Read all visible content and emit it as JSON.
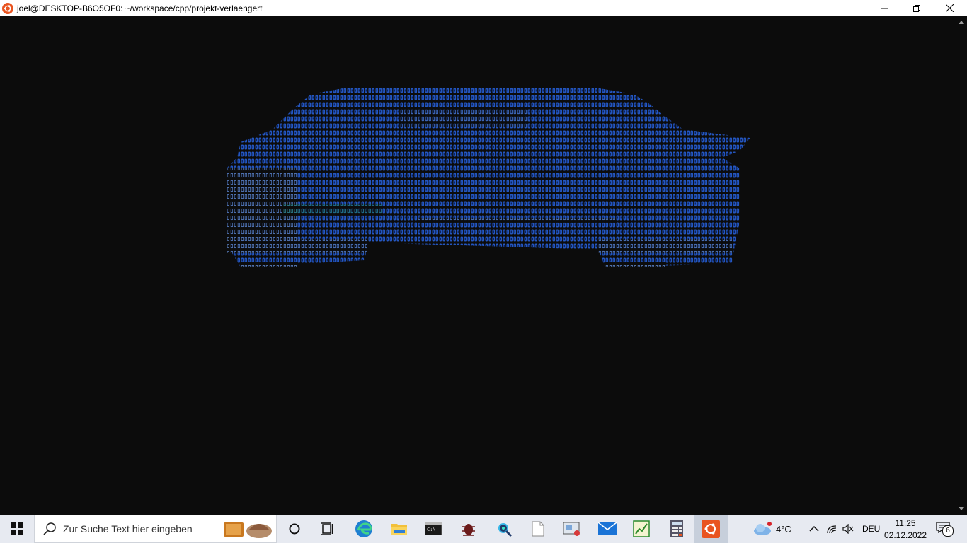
{
  "window": {
    "title": "joel@DESKTOP-B6O5OF0: ~/workspace/cpp/projekt-verlaengert",
    "minimize_icon": "minimize-icon",
    "restore_icon": "restore-icon",
    "close_icon": "close-icon"
  },
  "terminal": {
    "ascii_art": "car rendered in ASCII characters",
    "art_colors": [
      "#1f4fb0",
      "#2a5fc8",
      "#1d6f6a",
      "#6a7faf"
    ]
  },
  "taskbar": {
    "search_placeholder": "Zur Suche Text hier eingeben",
    "pinned": [
      {
        "icon": "windows-start-icon"
      },
      {
        "icon": "search-icon"
      },
      {
        "icon": "cortana-icon"
      },
      {
        "icon": "task-view-icon"
      },
      {
        "icon": "edge-icon"
      },
      {
        "icon": "file-explorer-icon"
      },
      {
        "icon": "terminal-icon"
      },
      {
        "icon": "bug-icon"
      },
      {
        "icon": "network-tool-icon"
      },
      {
        "icon": "document-icon"
      },
      {
        "icon": "remote-desktop-icon"
      },
      {
        "icon": "mail-icon"
      },
      {
        "icon": "chart-app-icon"
      },
      {
        "icon": "calculator-icon"
      },
      {
        "icon": "ubuntu-icon"
      }
    ],
    "weather": "4°C",
    "language": "DEU",
    "time": "11:25",
    "date": "02.12.2022",
    "notification_count": "6"
  }
}
